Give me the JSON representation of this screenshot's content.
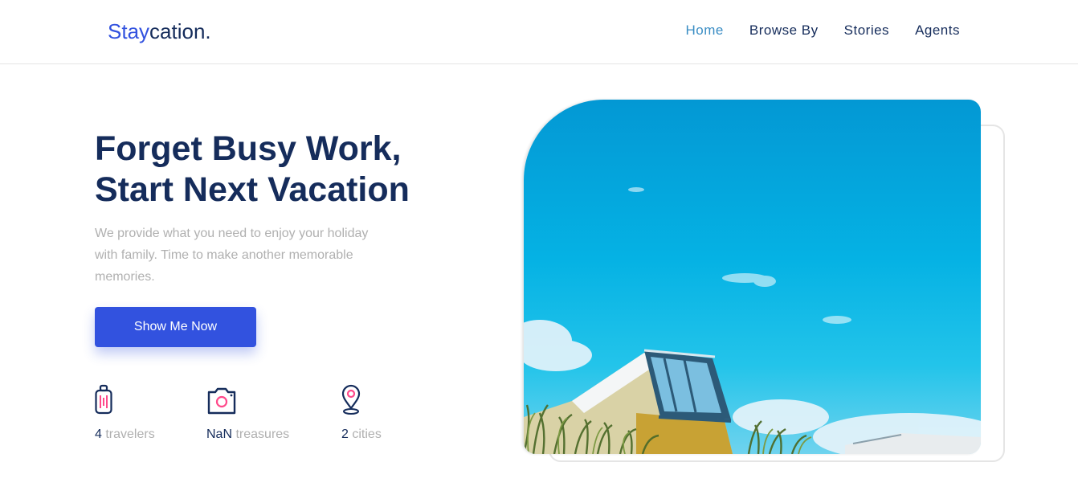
{
  "header": {
    "brand_accent": "Stay",
    "brand_rest": "cation.",
    "nav": [
      "Home",
      "Browse By",
      "Stories",
      "Agents"
    ],
    "active_nav": "Home"
  },
  "hero": {
    "title_line1": "Forget Busy Work,",
    "title_line2": "Start Next Vacation",
    "subtitle": "We provide what you need to enjoy your holiday with family. Time to make another memorable memories.",
    "cta_label": "Show Me Now"
  },
  "stats": [
    {
      "icon": "luggage-icon",
      "value": "4",
      "label": "travelers"
    },
    {
      "icon": "camera-icon",
      "value": "NaN",
      "label": "treasures"
    },
    {
      "icon": "map-pin-icon",
      "value": "2",
      "label": "cities"
    }
  ],
  "colors": {
    "primary": "#3252df",
    "navy": "#152c5b",
    "muted": "#b0b0b0",
    "active_nav": "#3a8dc4",
    "icon_accent": "#ff498b"
  }
}
